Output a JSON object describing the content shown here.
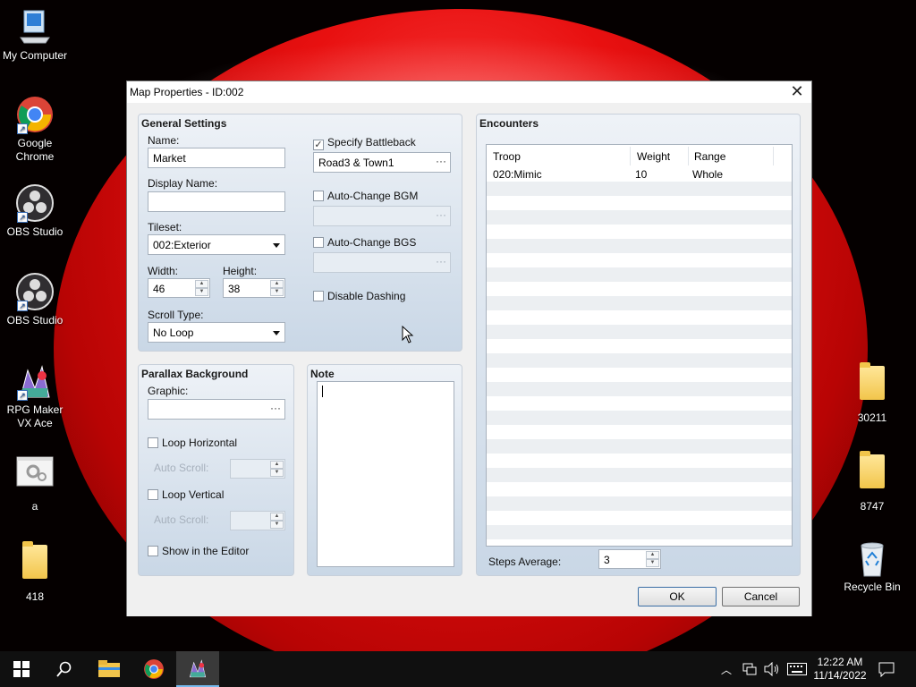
{
  "desktop": {
    "icons": [
      {
        "label": "My Computer",
        "icon": "computer-icon"
      },
      {
        "label": "Google Chrome",
        "icon": "chrome-icon"
      },
      {
        "label": "OBS Studio",
        "icon": "obs-icon"
      },
      {
        "label": "OBS Studio",
        "icon": "obs-icon"
      },
      {
        "label": "RPG Maker VX Ace",
        "icon": "rpgmaker-icon"
      },
      {
        "label": "a",
        "icon": "settings-file-icon"
      },
      {
        "label": "418",
        "icon": "folder-icon"
      },
      {
        "label": "30211",
        "icon": "folder-icon"
      },
      {
        "label": "8747",
        "icon": "folder-icon"
      },
      {
        "label": "Recycle Bin",
        "icon": "recycle-bin-icon"
      }
    ]
  },
  "dialog": {
    "title": "Map Properties - ID:002",
    "close_glyph": "✕",
    "general": {
      "title": "General Settings",
      "name_label": "Name:",
      "name_value": "Market",
      "display_name_label": "Display Name:",
      "display_name_value": "",
      "tileset_label": "Tileset:",
      "tileset_value": "002:Exterior",
      "width_label": "Width:",
      "width_value": "46",
      "height_label": "Height:",
      "height_value": "38",
      "scroll_type_label": "Scroll Type:",
      "scroll_type_value": "No Loop",
      "specify_battleback_label": "Specify Battleback",
      "specify_battleback_checked": true,
      "battleback_value": "Road3 & Town1",
      "auto_bgm_label": "Auto-Change BGM",
      "auto_bgs_label": "Auto-Change BGS",
      "disable_dashing_label": "Disable Dashing"
    },
    "parallax": {
      "title": "Parallax Background",
      "graphic_label": "Graphic:",
      "graphic_value": "",
      "loop_h_label": "Loop Horizontal",
      "auto_scroll_label_1": "Auto Scroll:",
      "loop_v_label": "Loop Vertical",
      "auto_scroll_label_2": "Auto Scroll:",
      "show_editor_label": "Show in the Editor"
    },
    "note": {
      "title": "Note",
      "value": ""
    },
    "encounters": {
      "title": "Encounters",
      "columns": [
        "Troop",
        "Weight",
        "Range"
      ],
      "rows": [
        {
          "troop": "020:Mimic",
          "weight": "10",
          "range": "Whole"
        }
      ],
      "steps_label": "Steps Average:",
      "steps_value": "3"
    },
    "buttons": {
      "ok": "OK",
      "cancel": "Cancel"
    },
    "ellipsis": "···",
    "check_glyph": "✓"
  },
  "taskbar": {
    "time": "12:22 AM",
    "date": "11/14/2022"
  }
}
